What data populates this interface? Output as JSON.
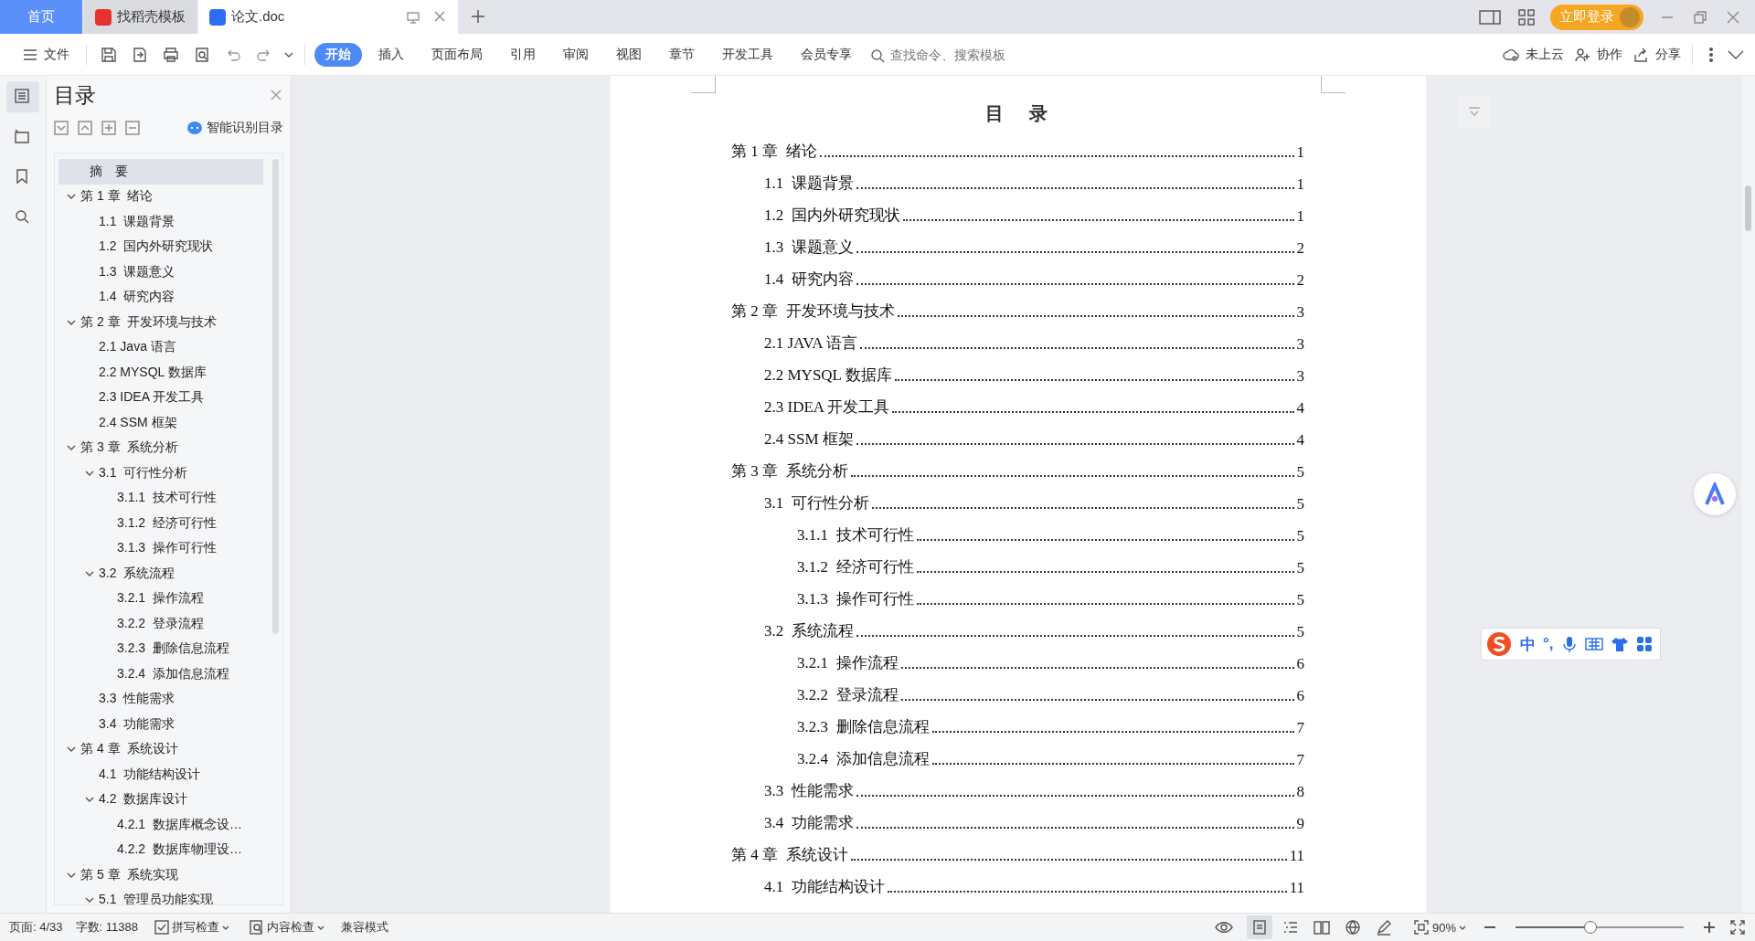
{
  "tabs": [
    {
      "label": "首页",
      "kind": "home",
      "selected": false
    },
    {
      "label": "找稻壳模板",
      "kind": "template",
      "selected": false
    },
    {
      "label": "论文.doc",
      "kind": "doc",
      "selected": true
    }
  ],
  "account": {
    "login_button": "立即登录"
  },
  "menu": {
    "file": "文件",
    "tabs": [
      {
        "label": "开始",
        "selected": true
      },
      {
        "label": "插入",
        "selected": false
      },
      {
        "label": "页面布局",
        "selected": false
      },
      {
        "label": "引用",
        "selected": false
      },
      {
        "label": "审阅",
        "selected": false
      },
      {
        "label": "视图",
        "selected": false
      },
      {
        "label": "章节",
        "selected": false
      },
      {
        "label": "开发工具",
        "selected": false
      },
      {
        "label": "会员专享",
        "selected": false
      }
    ],
    "search": {
      "placeholder": "查找命令、搜索模板"
    },
    "actions": [
      {
        "label": "未上云",
        "kind": "cloud"
      },
      {
        "label": "协作",
        "kind": "collab"
      },
      {
        "label": "分享",
        "kind": "share"
      }
    ]
  },
  "side_tools": [
    {
      "kind": "toc",
      "selected": true
    },
    {
      "kind": "select",
      "selected": false
    },
    {
      "kind": "bookmark",
      "selected": false
    },
    {
      "kind": "search",
      "selected": false
    }
  ],
  "nav": {
    "title": "目录",
    "smart_button": "智能识别目录",
    "items": [
      {
        "label": "摘　要",
        "selected": true
      },
      {
        "label": "第 1 章  绪论",
        "selected": false,
        "expanded": true,
        "children": [
          {
            "label": "1.1  课题背景",
            "selected": false
          },
          {
            "label": "1.2  国内外研究现状",
            "selected": false
          },
          {
            "label": "1.3  课题意义",
            "selected": false
          },
          {
            "label": "1.4  研究内容",
            "selected": false
          }
        ]
      },
      {
        "label": "第 2 章  开发环境与技术",
        "selected": false,
        "expanded": true,
        "children": [
          {
            "label": "2.1 Java 语言",
            "selected": false
          },
          {
            "label": "2.2 MYSQL 数据库",
            "selected": false
          },
          {
            "label": "2.3 IDEA 开发工具",
            "selected": false
          },
          {
            "label": "2.4 SSM 框架",
            "selected": false
          }
        ]
      },
      {
        "label": "第 3 章  系统分析",
        "selected": false,
        "expanded": true,
        "children": [
          {
            "label": "3.1  可行性分析",
            "selected": false,
            "expanded": true,
            "children": [
              {
                "label": "3.1.1  技术可行性",
                "selected": false
              },
              {
                "label": "3.1.2  经济可行性",
                "selected": false
              },
              {
                "label": "3.1.3  操作可行性",
                "selected": false
              }
            ]
          },
          {
            "label": "3.2  系统流程",
            "selected": false,
            "expanded": true,
            "children": [
              {
                "label": "3.2.1  操作流程",
                "selected": false
              },
              {
                "label": "3.2.2  登录流程",
                "selected": false
              },
              {
                "label": "3.2.3  删除信息流程",
                "selected": false
              },
              {
                "label": "3.2.4  添加信息流程",
                "selected": false
              }
            ]
          },
          {
            "label": "3.3  性能需求",
            "selected": false
          },
          {
            "label": "3.4  功能需求",
            "selected": false
          }
        ]
      },
      {
        "label": "第 4 章  系统设计",
        "selected": false,
        "expanded": true,
        "children": [
          {
            "label": "4.1  功能结构设计",
            "selected": false
          },
          {
            "label": "4.2  数据库设计",
            "selected": false,
            "expanded": true,
            "children": [
              {
                "label": "4.2.1  数据库概念设…",
                "selected": false
              },
              {
                "label": "4.2.2  数据库物理设…",
                "selected": false
              }
            ]
          }
        ]
      },
      {
        "label": "第 5 章  系统实现",
        "selected": false,
        "expanded": true,
        "children": [
          {
            "label": "5.1  管理员功能实现",
            "selected": false,
            "expanded": true
          }
        ]
      }
    ]
  },
  "document": {
    "title": "目　录",
    "toc": [
      {
        "label": "第 1 章  绪论",
        "page": "1",
        "children": [
          {
            "label": "1.1  课题背景",
            "page": "1"
          },
          {
            "label": "1.2  国内外研究现状",
            "page": "1"
          },
          {
            "label": "1.3  课题意义",
            "page": "2"
          },
          {
            "label": "1.4  研究内容",
            "page": "2"
          }
        ]
      },
      {
        "label": "第 2 章  开发环境与技术",
        "page": "3",
        "children": [
          {
            "label": "2.1 JAVA 语言",
            "page": "3"
          },
          {
            "label": "2.2 MYSQL 数据库",
            "page": "3"
          },
          {
            "label": "2.3 IDEA 开发工具",
            "page": "4"
          },
          {
            "label": "2.4 SSM 框架",
            "page": "4"
          }
        ]
      },
      {
        "label": "第 3 章  系统分析",
        "page": "5",
        "children": [
          {
            "label": "3.1  可行性分析",
            "page": "5",
            "children": [
              {
                "label": "3.1.1  技术可行性",
                "page": "5"
              },
              {
                "label": "3.1.2  经济可行性",
                "page": "5"
              },
              {
                "label": "3.1.3  操作可行性",
                "page": "5"
              }
            ]
          },
          {
            "label": "3.2  系统流程",
            "page": "5",
            "children": [
              {
                "label": "3.2.1  操作流程",
                "page": "6"
              },
              {
                "label": "3.2.2  登录流程",
                "page": "6"
              },
              {
                "label": "3.2.3  删除信息流程",
                "page": "7"
              },
              {
                "label": "3.2.4  添加信息流程",
                "page": "7"
              }
            ]
          },
          {
            "label": "3.3  性能需求",
            "page": "8"
          },
          {
            "label": "3.4  功能需求",
            "page": "9"
          }
        ]
      },
      {
        "label": "第 4 章  系统设计",
        "page": "11",
        "children": [
          {
            "label": "4.1  功能结构设计",
            "page": "11"
          }
        ]
      }
    ]
  },
  "ime": {
    "labels": [
      "中",
      "°,"
    ]
  },
  "status": {
    "page": "页面: 4/33",
    "words": "字数: 11388",
    "spell": "拼写检查",
    "content": "内容检查",
    "compat": "兼容模式",
    "zoom": "90%",
    "zoom_slider": {
      "level": 0.44
    },
    "views": [
      {
        "kind": "page",
        "selected": true
      },
      {
        "kind": "outline",
        "selected": false
      },
      {
        "kind": "read",
        "selected": false
      },
      {
        "kind": "web",
        "selected": false
      },
      {
        "kind": "write",
        "selected": false
      }
    ]
  }
}
